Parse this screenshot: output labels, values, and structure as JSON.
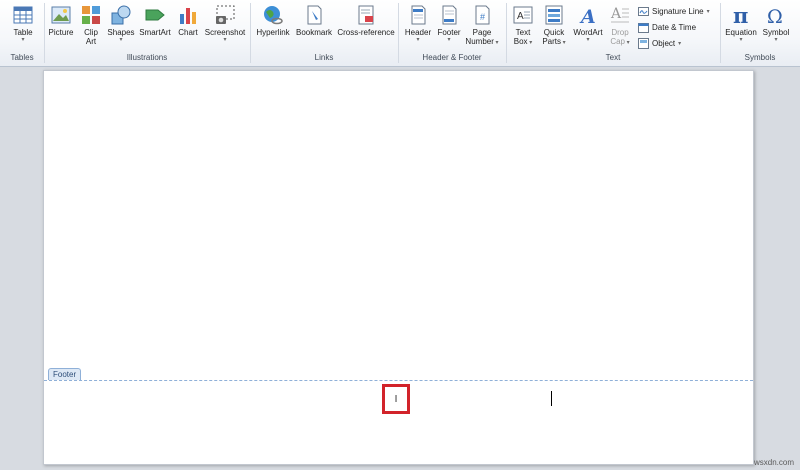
{
  "ribbon": {
    "groups": {
      "tables": "Tables",
      "illustrations": "Illustrations",
      "links": "Links",
      "header_footer": "Header & Footer",
      "text": "Text",
      "symbols": "Symbols"
    },
    "buttons": {
      "table": "Table",
      "picture": "Picture",
      "clip_art_1": "Clip",
      "clip_art_2": "Art",
      "shapes": "Shapes",
      "smartart": "SmartArt",
      "chart": "Chart",
      "screenshot": "Screenshot",
      "hyperlink": "Hyperlink",
      "bookmark": "Bookmark",
      "cross_reference": "Cross-reference",
      "header": "Header",
      "footer": "Footer",
      "page_number_1": "Page",
      "page_number_2": "Number",
      "text_box_1": "Text",
      "text_box_2": "Box",
      "quick_parts_1": "Quick",
      "quick_parts_2": "Parts",
      "wordart": "WordArt",
      "drop_cap_1": "Drop",
      "drop_cap_2": "Cap",
      "signature_line": "Signature Line",
      "date_time": "Date & Time",
      "object": "Object",
      "equation": "Equation",
      "symbol": "Symbol"
    }
  },
  "page": {
    "footer_tab": "Footer",
    "page_number_text": "I"
  },
  "watermark": "wsxdn.com",
  "colors": {
    "highlight": "#d2232a",
    "footer_border": "#8fb0d8"
  }
}
